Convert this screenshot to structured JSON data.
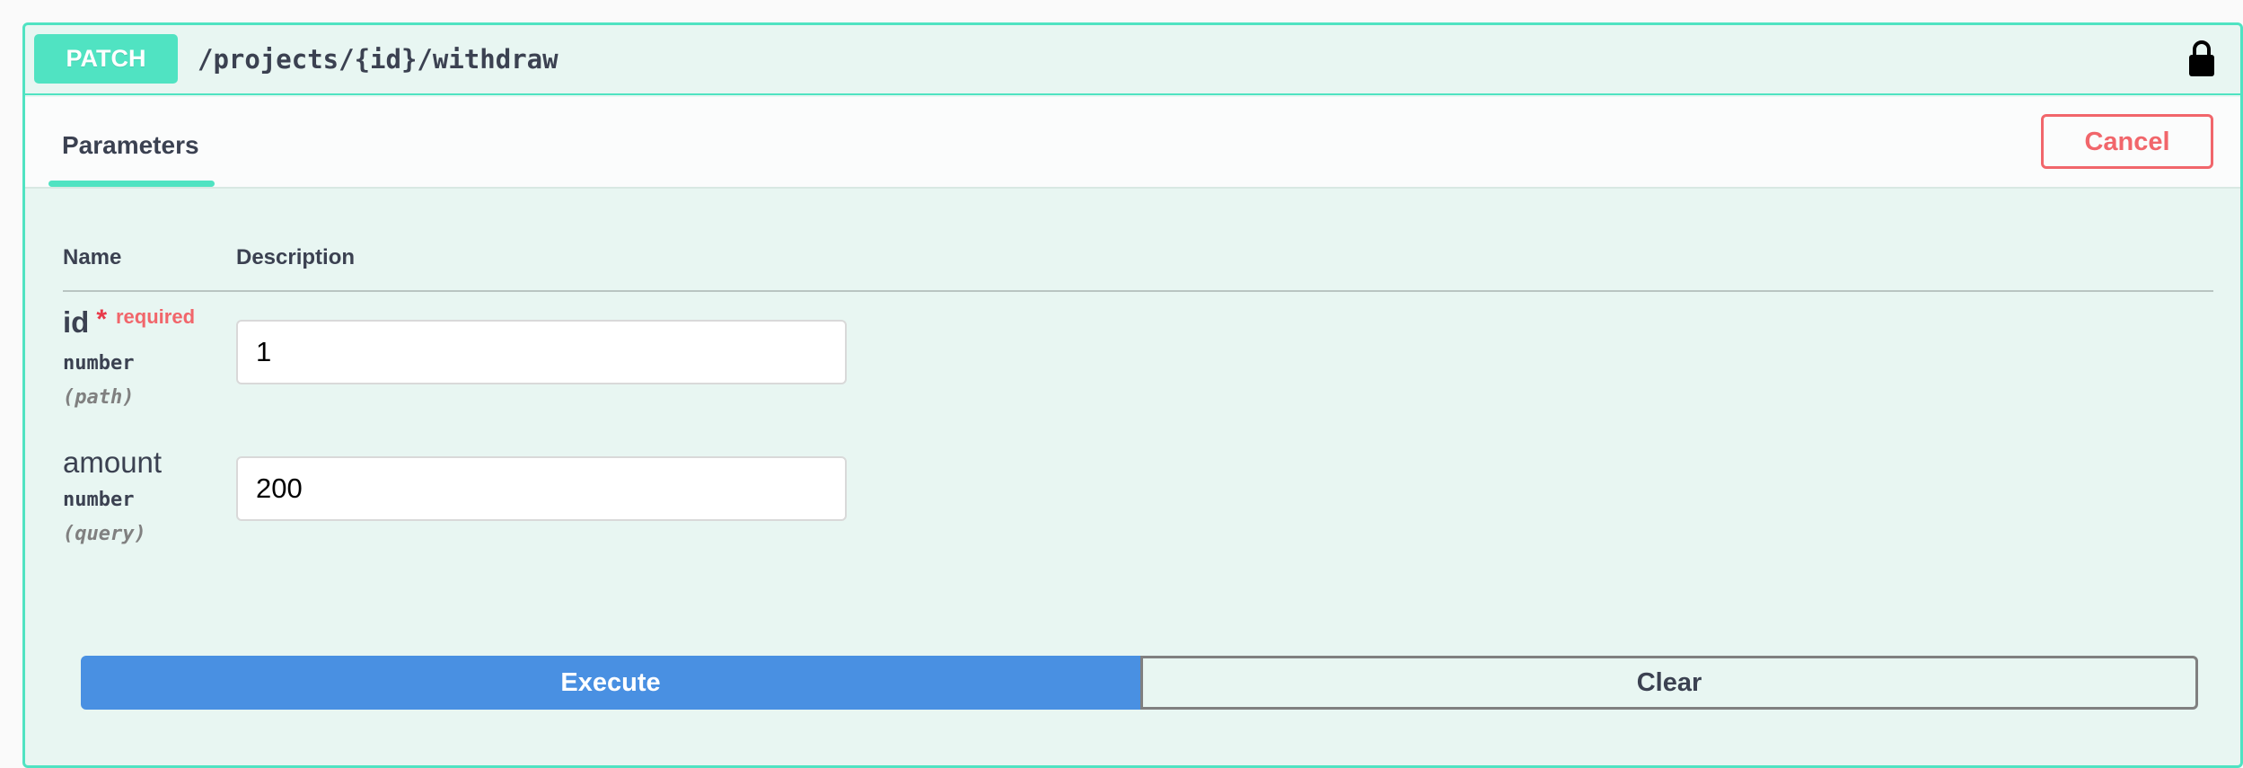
{
  "operation": {
    "method": "PATCH",
    "path": "/projects/{id}/withdraw",
    "lock_icon": "lock-icon",
    "method_color": "#50e3c2"
  },
  "section": {
    "tab_label": "Parameters",
    "cancel_label": "Cancel"
  },
  "table": {
    "name_header": "Name",
    "description_header": "Description"
  },
  "parameters": [
    {
      "name": "id",
      "required_mark": "*",
      "required_label": "required",
      "type": "number",
      "in": "(path)",
      "value": "1"
    },
    {
      "name": "amount",
      "type": "number",
      "in": "(query)",
      "value": "200"
    }
  ],
  "actions": {
    "execute_label": "Execute",
    "clear_label": "Clear",
    "execute_color": "#4990e2"
  }
}
